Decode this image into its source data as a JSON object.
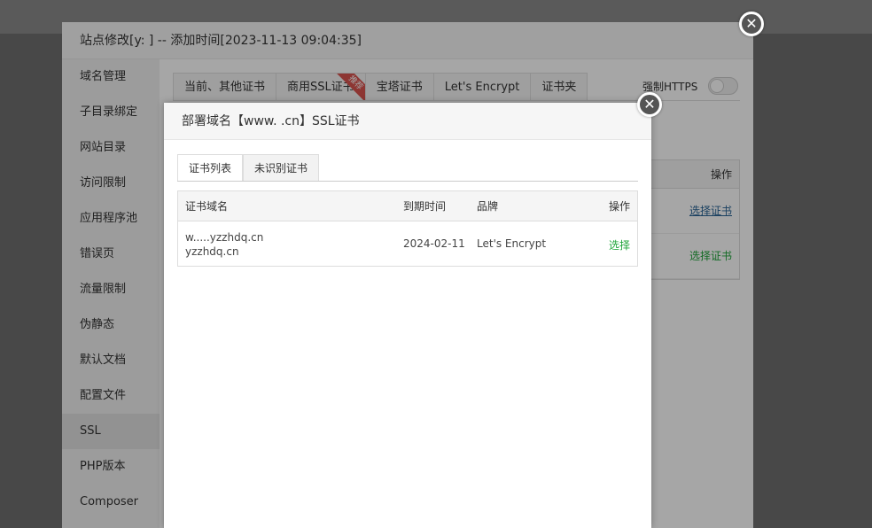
{
  "outer_dialog": {
    "title": "站点修改[y:          ] -- 添加时间[2023-11-13 09:04:35]",
    "close_glyph": "✕"
  },
  "sidebar": {
    "items": [
      {
        "label": "域名管理"
      },
      {
        "label": "子目录绑定"
      },
      {
        "label": "网站目录"
      },
      {
        "label": "访问限制"
      },
      {
        "label": "应用程序池"
      },
      {
        "label": "错误页"
      },
      {
        "label": "流量限制"
      },
      {
        "label": "伪静态"
      },
      {
        "label": "默认文档"
      },
      {
        "label": "配置文件"
      },
      {
        "label": "SSL"
      },
      {
        "label": "PHP版本"
      },
      {
        "label": "Composer"
      }
    ],
    "active": "SSL"
  },
  "ssl_tabs": [
    {
      "label": "当前、其他证书"
    },
    {
      "label": "商用SSL证书"
    },
    {
      "label": "宝塔证书"
    },
    {
      "label": "Let's Encrypt"
    },
    {
      "label": "证书夹"
    }
  ],
  "ribbon_label": "推荐",
  "force_https": {
    "label": "强制HTTPS",
    "enabled": false
  },
  "background_table": {
    "header": "操作",
    "rows": [
      {
        "action": "选择证书"
      },
      {
        "action": "选择证书"
      }
    ]
  },
  "deploy_dialog": {
    "title": "部署域名【www.           .cn】SSL证书",
    "close_glyph": "✕",
    "tabs": [
      {
        "label": "证书列表"
      },
      {
        "label": "未识别证书"
      }
    ],
    "columns": {
      "domain": "证书域名",
      "expiry": "到期时间",
      "brand": "品牌",
      "action": "操作"
    },
    "rows": [
      {
        "domain_line1": "w.....yzzhdq.cn",
        "domain_line2": "yzzhdq.cn",
        "expiry": "2024-02-11",
        "brand": "Let's Encrypt",
        "action": "选择"
      }
    ]
  },
  "colors": {
    "accent_green": "#20a53a",
    "ribbon_red": "#d9534f",
    "link_blue": "#2a6496"
  }
}
